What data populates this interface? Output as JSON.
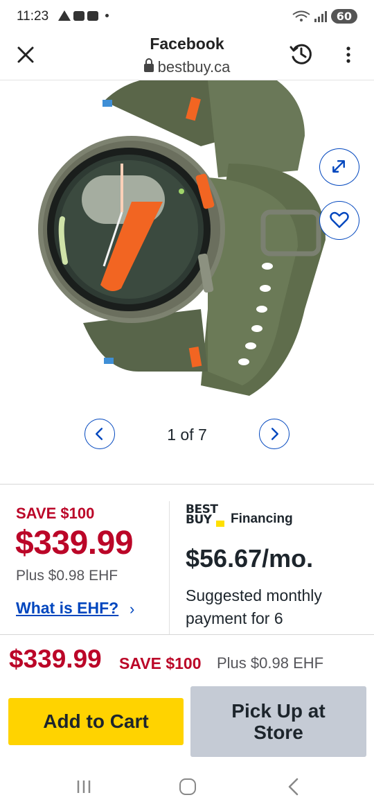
{
  "status_bar": {
    "time": "11:23",
    "battery": "60"
  },
  "browser": {
    "title": "Facebook",
    "url": "bestbuy.ca"
  },
  "carousel": {
    "page_indicator": "1 of 7"
  },
  "pricing": {
    "save_label": "SAVE $100",
    "price": "$339.99",
    "ehf_note": "Plus $0.98 EHF",
    "ehf_link": "What is EHF?",
    "ehf_chevron": "›"
  },
  "financing": {
    "logo_line1": "BEST",
    "logo_line2": "BUY",
    "label": "Financing",
    "monthly_price": "$56.67/mo.",
    "description": "Suggested monthly payment for 6"
  },
  "sticky": {
    "price": "$339.99",
    "save": "SAVE $100",
    "ehf": "Plus $0.98 EHF",
    "add_to_cart": "Add to Cart",
    "pickup": "Pick Up at Store"
  },
  "colors": {
    "brand_blue": "#0046be",
    "sale_red": "#bb0628",
    "cart_yellow": "#ffd300",
    "pickup_grey": "#c5cbd5",
    "watch_green": "#5c6b4f",
    "watch_orange": "#f26522"
  },
  "icons": [
    "close-icon",
    "lock-icon",
    "history-icon",
    "more-vert-icon",
    "expand-icon",
    "heart-icon",
    "chevron-left-icon",
    "chevron-right-icon",
    "nav-recents-icon",
    "nav-home-icon",
    "nav-back-icon"
  ]
}
